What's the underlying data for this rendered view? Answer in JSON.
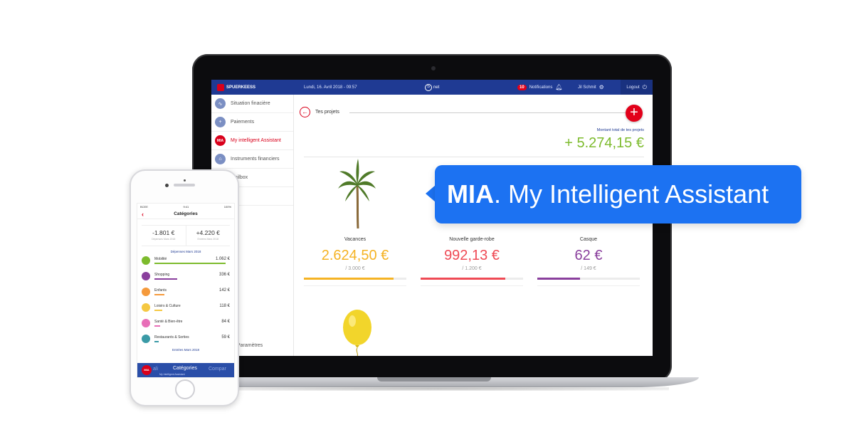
{
  "laptop": {
    "topbar": {
      "brand": "SPUERKEESS",
      "date": "Lundi, 16. Avril 2018 - 09:57",
      "snet_label": "net",
      "notif_count": "10",
      "notif_label": "Notifications",
      "user": "Jil Schmit",
      "logout": "Logout"
    },
    "sidebar": {
      "items": [
        {
          "label": "Situation finacière",
          "icon": "chart-line-icon"
        },
        {
          "label": "Paiements",
          "icon": "plus-icon"
        },
        {
          "label": "My intelligent Assistant",
          "icon": "MIA"
        },
        {
          "label": "Instruments financiers",
          "icon": "bank-icon"
        },
        {
          "label": "Mailbox",
          "icon": "mail-icon"
        },
        {
          "label": "e",
          "icon": "profile-icon"
        }
      ],
      "settings": "Paramètres"
    },
    "projects": {
      "back_icon": "←",
      "title": "Tes projets",
      "add_icon": "+",
      "total_label": "Montant total de tes projets",
      "total_value": "+ 5.274,15 €",
      "cards": [
        {
          "name": "Vacances",
          "amount": "2.624,50 €",
          "target": "/ 3.000 €",
          "progress": 0.875,
          "color": "#f5b324"
        },
        {
          "name": "Nouvelle garde-robe",
          "amount": "992,13 €",
          "target": "/ 1.200 €",
          "progress": 0.827,
          "color": "#ef4a55"
        },
        {
          "name": "Casque",
          "amount": "62 €",
          "target": "/ 149 €",
          "progress": 0.416,
          "color": "#8a3f9d"
        }
      ]
    }
  },
  "bubble": {
    "bold": "MIA",
    "rest": ". My Intelligent Assistant",
    "color": "#1c72f2"
  },
  "phone": {
    "status": {
      "carrier": "BCEE",
      "time": "9:41",
      "battery": "100%"
    },
    "back_icon": "‹",
    "title": "Catégories",
    "summary": [
      {
        "value": "-1.801 €",
        "label": "Dépenses Mars 2018"
      },
      {
        "value": "+4.220 €",
        "label": "Entrées Mars 2018"
      }
    ],
    "expenses_label": "Dépenses Mars 2018",
    "categories": [
      {
        "name": "Mobilité",
        "amount": "1.062 €",
        "color": "#7dbb2d",
        "share": 1.0
      },
      {
        "name": "Shopping",
        "amount": "336 €",
        "color": "#8a3f9d",
        "share": 0.32
      },
      {
        "name": "Enfants",
        "amount": "142 €",
        "color": "#f59a3c",
        "share": 0.14
      },
      {
        "name": "Loisirs & Culture",
        "amount": "118 €",
        "color": "#f5c842",
        "share": 0.11
      },
      {
        "name": "Santé & Bien-être",
        "amount": "84 €",
        "color": "#e86fb8",
        "share": 0.08
      },
      {
        "name": "Restaurants & Sorties",
        "amount": "59 €",
        "color": "#3a9aa6",
        "share": 0.06
      }
    ],
    "income_label": "Entrées Mars 2018",
    "tabbar": {
      "mia": "MIA",
      "prev": "ali",
      "active": "Catégories",
      "next": "Compar",
      "mia_label": "My Intelligent Assistant"
    }
  }
}
